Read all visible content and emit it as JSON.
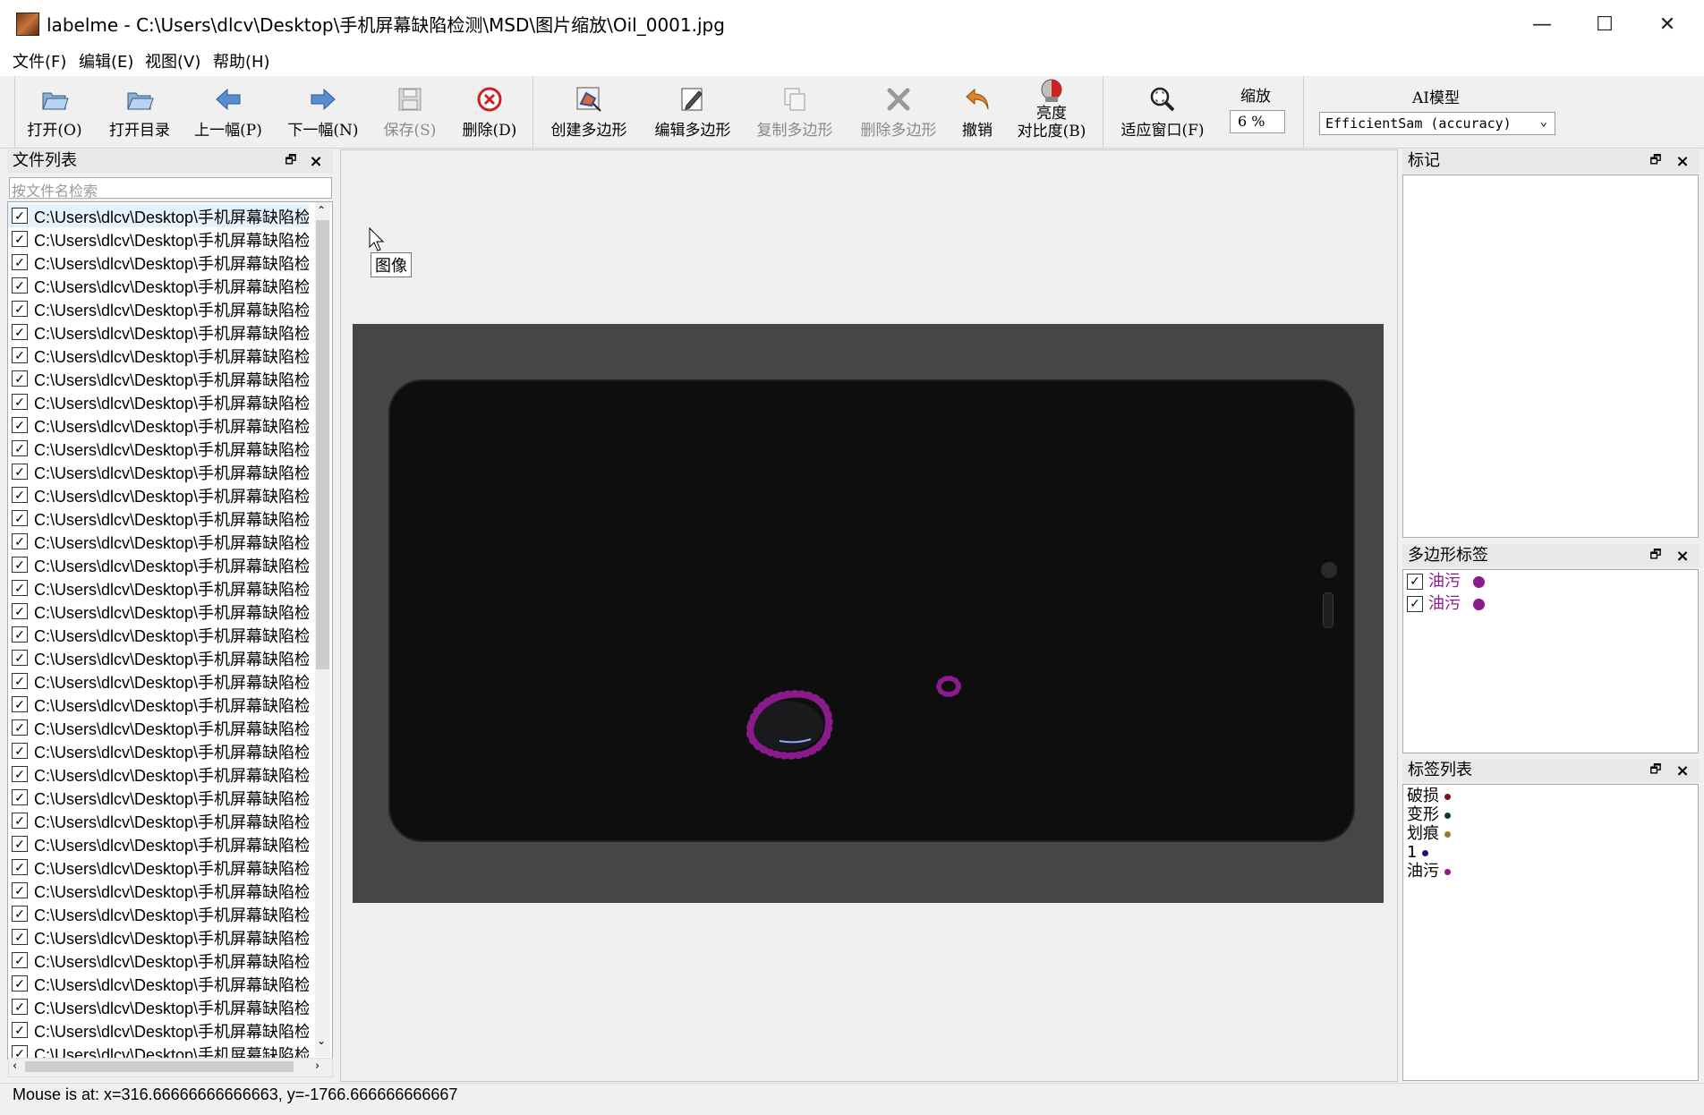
{
  "window": {
    "title": "labelme - C:\\Users\\dlcv\\Desktop\\手机屏幕缺陷检测\\MSD\\图片缩放\\Oil_0001.jpg",
    "minimize": "—",
    "maximize": "☐",
    "close": "✕"
  },
  "menu": [
    "文件(F)",
    "编辑(E)",
    "视图(V)",
    "帮助(H)"
  ],
  "toolbar": {
    "open": "打开(O)",
    "open_dir": "打开目录",
    "prev": "上一幅(P)",
    "next": "下一幅(N)",
    "save": "保存(S)",
    "delete": "删除(D)",
    "create_polygon": "创建多边形",
    "edit_polygon": "编辑多边形",
    "copy_polygon": "复制多边形",
    "delete_polygon": "删除多边形",
    "undo": "撤销",
    "brightness_1": "亮度",
    "brightness_2": "对比度(B)",
    "fit_window": "适应窗口(F)",
    "zoom_label": "缩放",
    "zoom_value": "6 %",
    "ai_label": "AI模型",
    "ai_model": "EfficientSam (accuracy)"
  },
  "file_dock": {
    "title": "文件列表",
    "search_placeholder": "按文件名检索",
    "items": [
      "C:\\Users\\dlcv\\Desktop\\手机屏幕缺陷检测",
      "C:\\Users\\dlcv\\Desktop\\手机屏幕缺陷检测",
      "C:\\Users\\dlcv\\Desktop\\手机屏幕缺陷检测",
      "C:\\Users\\dlcv\\Desktop\\手机屏幕缺陷检测",
      "C:\\Users\\dlcv\\Desktop\\手机屏幕缺陷检测",
      "C:\\Users\\dlcv\\Desktop\\手机屏幕缺陷检测",
      "C:\\Users\\dlcv\\Desktop\\手机屏幕缺陷检测",
      "C:\\Users\\dlcv\\Desktop\\手机屏幕缺陷检测",
      "C:\\Users\\dlcv\\Desktop\\手机屏幕缺陷检测",
      "C:\\Users\\dlcv\\Desktop\\手机屏幕缺陷检测",
      "C:\\Users\\dlcv\\Desktop\\手机屏幕缺陷检测",
      "C:\\Users\\dlcv\\Desktop\\手机屏幕缺陷检测",
      "C:\\Users\\dlcv\\Desktop\\手机屏幕缺陷检测",
      "C:\\Users\\dlcv\\Desktop\\手机屏幕缺陷检测",
      "C:\\Users\\dlcv\\Desktop\\手机屏幕缺陷检测",
      "C:\\Users\\dlcv\\Desktop\\手机屏幕缺陷检测",
      "C:\\Users\\dlcv\\Desktop\\手机屏幕缺陷检测",
      "C:\\Users\\dlcv\\Desktop\\手机屏幕缺陷检测",
      "C:\\Users\\dlcv\\Desktop\\手机屏幕缺陷检测",
      "C:\\Users\\dlcv\\Desktop\\手机屏幕缺陷检测",
      "C:\\Users\\dlcv\\Desktop\\手机屏幕缺陷检测",
      "C:\\Users\\dlcv\\Desktop\\手机屏幕缺陷检测",
      "C:\\Users\\dlcv\\Desktop\\手机屏幕缺陷检测",
      "C:\\Users\\dlcv\\Desktop\\手机屏幕缺陷检测",
      "C:\\Users\\dlcv\\Desktop\\手机屏幕缺陷检测",
      "C:\\Users\\dlcv\\Desktop\\手机屏幕缺陷检测",
      "C:\\Users\\dlcv\\Desktop\\手机屏幕缺陷检测",
      "C:\\Users\\dlcv\\Desktop\\手机屏幕缺陷检测",
      "C:\\Users\\dlcv\\Desktop\\手机屏幕缺陷检测",
      "C:\\Users\\dlcv\\Desktop\\手机屏幕缺陷检测",
      "C:\\Users\\dlcv\\Desktop\\手机屏幕缺陷检测",
      "C:\\Users\\dlcv\\Desktop\\手机屏幕缺陷检测",
      "C:\\Users\\dlcv\\Desktop\\手机屏幕缺陷检测",
      "C:\\Users\\dlcv\\Desktop\\手机屏幕缺陷检测",
      "C:\\Users\\dlcv\\Desktop\\手机屏幕缺陷检测",
      "C:\\Users\\dlcv\\Desktop\\手机屏幕缺陷检测",
      "C:\\Users\\dlcv\\Desktop\\手机屏幕缺陷检测"
    ]
  },
  "canvas": {
    "tooltip": "图像"
  },
  "flags_dock": {
    "title": "标记"
  },
  "polygon_dock": {
    "title": "多边形标签",
    "items": [
      {
        "label": "油污",
        "color": "#8b1a8b"
      },
      {
        "label": "油污",
        "color": "#8b1a8b"
      }
    ]
  },
  "label_dock": {
    "title": "标签列表",
    "items": [
      {
        "label": "破损",
        "color": "#7a1010"
      },
      {
        "label": "变形",
        "color": "#0a3a3a"
      },
      {
        "label": "划痕",
        "color": "#9a7a2a"
      },
      {
        "label": "1",
        "color": "#151570"
      },
      {
        "label": "油污",
        "color": "#8b1a8b"
      }
    ]
  },
  "status": "Mouse is at: x=316.66666666666663, y=-1766.666666666667"
}
